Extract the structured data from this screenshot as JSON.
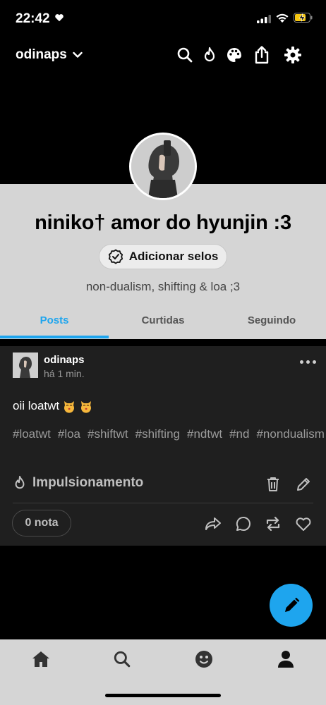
{
  "status_bar": {
    "time": "22:42"
  },
  "top_bar": {
    "blog_name": "odinaps"
  },
  "profile": {
    "title": "niniko† amor do hyunjin :3",
    "badge_button": "Adicionar selos",
    "description": "non-dualism, shifting & loa ;3"
  },
  "tabs": [
    {
      "label": "Posts",
      "active": true
    },
    {
      "label": "Curtidas",
      "active": false
    },
    {
      "label": "Seguindo",
      "active": false
    }
  ],
  "post": {
    "author": "odinaps",
    "time": "há 1 min.",
    "text": "oii loatwt",
    "tags": [
      "#loatwt",
      "#loa",
      "#shiftwt",
      "#shifting",
      "#ndtwt",
      "#nd",
      "#nondualism"
    ],
    "boost_label": "Impulsionamento",
    "notes": "0 nota"
  },
  "colors": {
    "accent": "#1ea5ee",
    "header_bg": "#d5d5d5",
    "card_bg": "#1f1f1f"
  },
  "icons": {
    "top_bar": [
      "search-icon",
      "flame-icon",
      "palette-icon",
      "share-icon",
      "gear-icon"
    ],
    "post_actions": [
      "share-arrow-icon",
      "comment-icon",
      "reblog-icon",
      "heart-icon"
    ],
    "bottom_nav": [
      "home-icon",
      "search-icon",
      "activity-icon",
      "profile-icon"
    ]
  }
}
